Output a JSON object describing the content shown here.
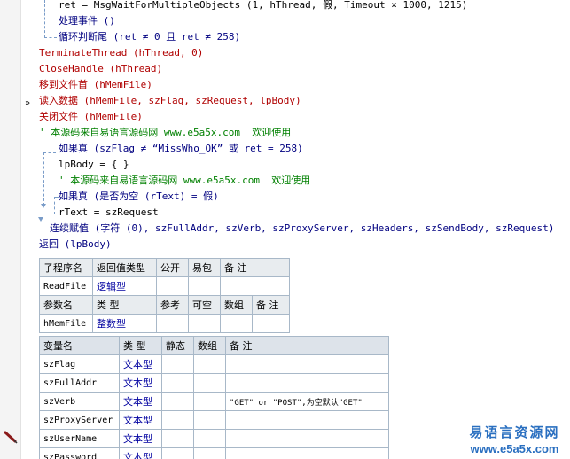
{
  "code": {
    "lines": [
      {
        "text": "ret = MsgWaitForMultipleObjects (1, hThread, 假, Timeout × 1000, 1215)"
      },
      {
        "text": "处理事件 ()"
      },
      {
        "text": "循环判断尾 (ret ≠ 0 且 ret ≠ 258)"
      },
      {
        "text": "TerminateThread (hThread, 0)"
      },
      {
        "text": "CloseHandle (hThread)"
      },
      {
        "text": "移到文件首 (hMemFile)"
      },
      {
        "text": "读入数据 (hMemFile, szFlag, szRequest, lpBody)"
      },
      {
        "text": "关闭文件 (hMemFile)"
      },
      {
        "text": "' 本源码来自易语言源码网 www.e5a5x.com  欢迎使用"
      },
      {
        "text": "如果真 (szFlag ≠ “MissWho_OK” 或 ret = 258)"
      },
      {
        "text": "lpBody = { }"
      },
      {
        "text": "' 本源码来自易语言源码网 www.e5a5x.com  欢迎使用"
      },
      {
        "text": "如果真 (是否为空 (rText) = 假)"
      },
      {
        "text": "rText = szRequest"
      },
      {
        "text": "连续赋值 (字符 (0), szFullAddr, szVerb, szProxyServer, szHeaders, szSendBody, szRequest)"
      },
      {
        "text": "返回 (lpBody)"
      }
    ]
  },
  "sub_table": {
    "headers": [
      "子程序名",
      "返回值类型",
      "公开",
      "易包",
      "备 注"
    ],
    "row": {
      "name": "ReadFile",
      "type": "逻辑型",
      "public": "",
      "pkg": "",
      "note": ""
    }
  },
  "param_table": {
    "headers": [
      "参数名",
      "类 型",
      "参考",
      "可空",
      "数组",
      "备 注"
    ],
    "row": {
      "name": "hMemFile",
      "type": "整数型",
      "ref": "",
      "nullable": "",
      "array": "",
      "note": ""
    }
  },
  "var_table": {
    "headers": [
      "变量名",
      "类 型",
      "静态",
      "数组",
      "备 注"
    ],
    "rows": [
      {
        "name": "szFlag",
        "type": "文本型",
        "note": ""
      },
      {
        "name": "szFullAddr",
        "type": "文本型",
        "note": ""
      },
      {
        "name": "szVerb",
        "type": "文本型",
        "note": "\"GET\" or \"POST\",为空默认\"GET\""
      },
      {
        "name": "szProxyServer",
        "type": "文本型",
        "note": ""
      },
      {
        "name": "szUserName",
        "type": "文本型",
        "note": ""
      },
      {
        "name": "szPassword",
        "type": "文本型",
        "note": ""
      }
    ]
  },
  "watermark": {
    "cn": "易语言资源网",
    "url": "www.e5a5x.com"
  },
  "colors": {
    "keyword_red": "#b00000",
    "flow_blue": "#000080",
    "comment_green": "#008000",
    "type_blue": "#0000a0",
    "header_bg": "#e8ecef"
  },
  "icons": {
    "breakpoint": "double-chevron-right-icon",
    "edit": "pencil-icon"
  }
}
